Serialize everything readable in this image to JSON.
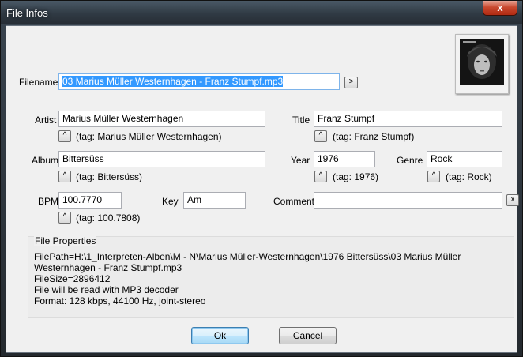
{
  "window": {
    "title": "File Infos",
    "close_label": "x"
  },
  "filename": {
    "label": "Filename",
    "value": "03 Marius Müller Westernhagen - Franz Stumpf.mp3",
    "button": ">"
  },
  "artist": {
    "label": "Artist",
    "value": "Marius Müller Westernhagen",
    "tag": "(tag: Marius Müller Westernhagen)"
  },
  "title": {
    "label": "Title",
    "value": "Franz Stumpf",
    "tag": "(tag: Franz Stumpf)"
  },
  "album": {
    "label": "Album",
    "value": "Bittersüss",
    "tag": "(tag: Bittersüss)"
  },
  "year": {
    "label": "Year",
    "value": "1976",
    "tag": "(tag: 1976)"
  },
  "genre": {
    "label": "Genre",
    "value": "Rock",
    "tag": "(tag: Rock)"
  },
  "bpm": {
    "label": "BPM",
    "value": "100.7770",
    "tag": "(tag: 100.7808)"
  },
  "key": {
    "label": "Key",
    "value": "Am"
  },
  "comment": {
    "label": "Comment",
    "value": "",
    "clear_button": "x"
  },
  "up_button": "^",
  "file_properties": {
    "title": "File Properties",
    "lines": [
      "FilePath=H:\\1_Interpreten-Alben\\M - N\\Marius Müller-Westernhagen\\1976 Bittersüss\\03 Marius Müller Westernhagen - Franz Stumpf.mp3",
      "FileSize=2896412",
      "File will be read with MP3 decoder",
      "Format: 128 kbps, 44100 Hz, joint-stereo"
    ]
  },
  "buttons": {
    "ok": "Ok",
    "cancel": "Cancel"
  }
}
